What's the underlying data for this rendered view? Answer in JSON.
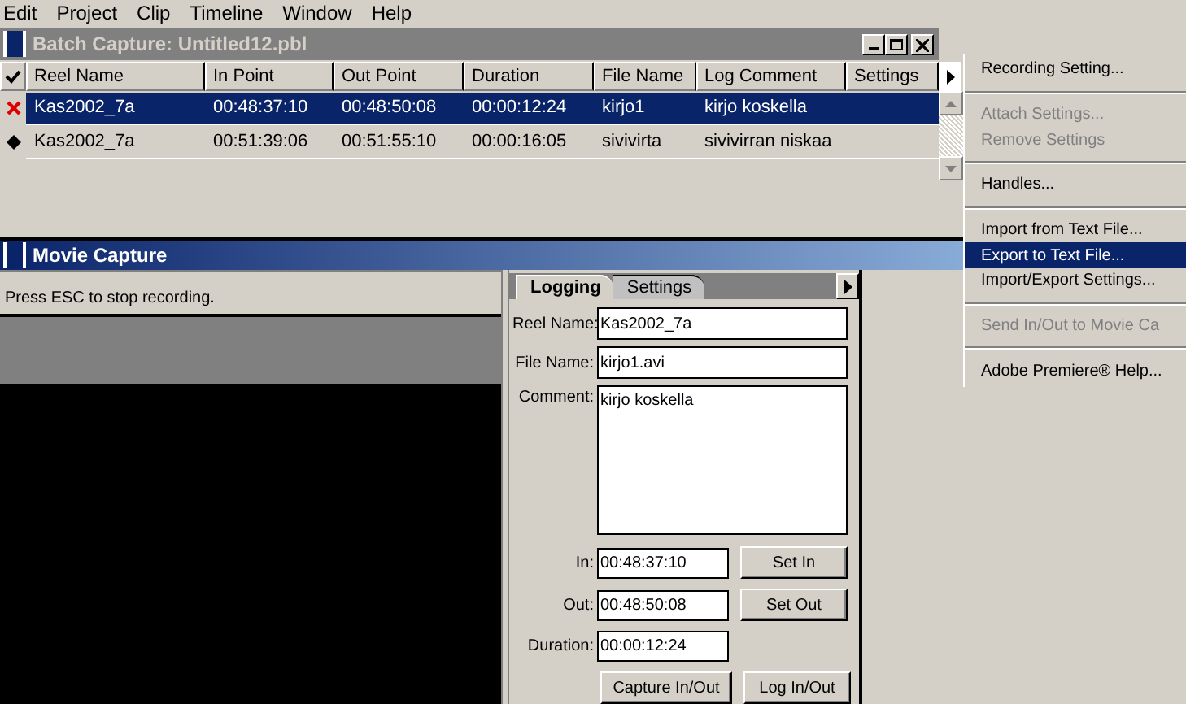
{
  "menubar": [
    "Edit",
    "Project",
    "Clip",
    "Timeline",
    "Window",
    "Help"
  ],
  "batch_capture": {
    "title": "Batch Capture: Untitled12.pbl",
    "columns": [
      "Reel Name",
      "In Point",
      "Out Point",
      "Duration",
      "File Name",
      "Log Comment",
      "Settings"
    ],
    "rows": [
      {
        "kind": "error",
        "selected": true,
        "cells": [
          "Kas2002_7a",
          "00:48:37:10",
          "00:48:50:08",
          "00:00:12:24",
          "kirjo1",
          "kirjo koskella",
          ""
        ]
      },
      {
        "kind": "ready",
        "selected": false,
        "cells": [
          "Kas2002_7a",
          "00:51:39:06",
          "00:51:55:10",
          "00:00:16:05",
          "sivivirta",
          "sivivirran niskaa",
          ""
        ]
      }
    ]
  },
  "menu": [
    {
      "kind": "item",
      "label": "Recording Setting...",
      "disabled": false,
      "selected": false
    },
    {
      "kind": "separator"
    },
    {
      "kind": "item",
      "label": "Attach Settings...",
      "disabled": true,
      "selected": false
    },
    {
      "kind": "item",
      "label": "Remove Settings",
      "disabled": true,
      "selected": false
    },
    {
      "kind": "separator"
    },
    {
      "kind": "item",
      "label": "Handles...",
      "disabled": false,
      "selected": false
    },
    {
      "kind": "separator"
    },
    {
      "kind": "item",
      "label": "Import from Text File...",
      "disabled": false,
      "selected": false
    },
    {
      "kind": "item",
      "label": "Export to Text File...",
      "disabled": false,
      "selected": true
    },
    {
      "kind": "item",
      "label": "Import/Export Settings...",
      "disabled": false,
      "selected": false
    },
    {
      "kind": "separator"
    },
    {
      "kind": "item",
      "label": "Send In/Out to Movie Ca",
      "disabled": true,
      "selected": false
    },
    {
      "kind": "separator"
    },
    {
      "kind": "item",
      "label": "Adobe Premiere® Help...",
      "disabled": false,
      "selected": false
    }
  ],
  "movie_capture": {
    "title": "Movie Capture",
    "status_text": "Press ESC to stop recording.",
    "tabs": [
      {
        "label": "Logging",
        "selected": true
      },
      {
        "label": "Settings",
        "selected": false
      }
    ],
    "fields": [
      {
        "label": "Reel Name:",
        "value": "Kas2002_7a"
      },
      {
        "label": "File Name:",
        "value": "kirjo1.avi"
      }
    ],
    "comment": {
      "label": "Comment:",
      "value": "kirjo koskella"
    },
    "timecodes": [
      {
        "label": "In:",
        "value": "00:48:37:10",
        "button": "Set In"
      },
      {
        "label": "Out:",
        "value": "00:48:50:08",
        "button": "Set Out"
      },
      {
        "label": "Duration:",
        "value": "00:00:12:24"
      }
    ],
    "buttons": [
      "Capture In/Out",
      "Log In/Out"
    ]
  }
}
